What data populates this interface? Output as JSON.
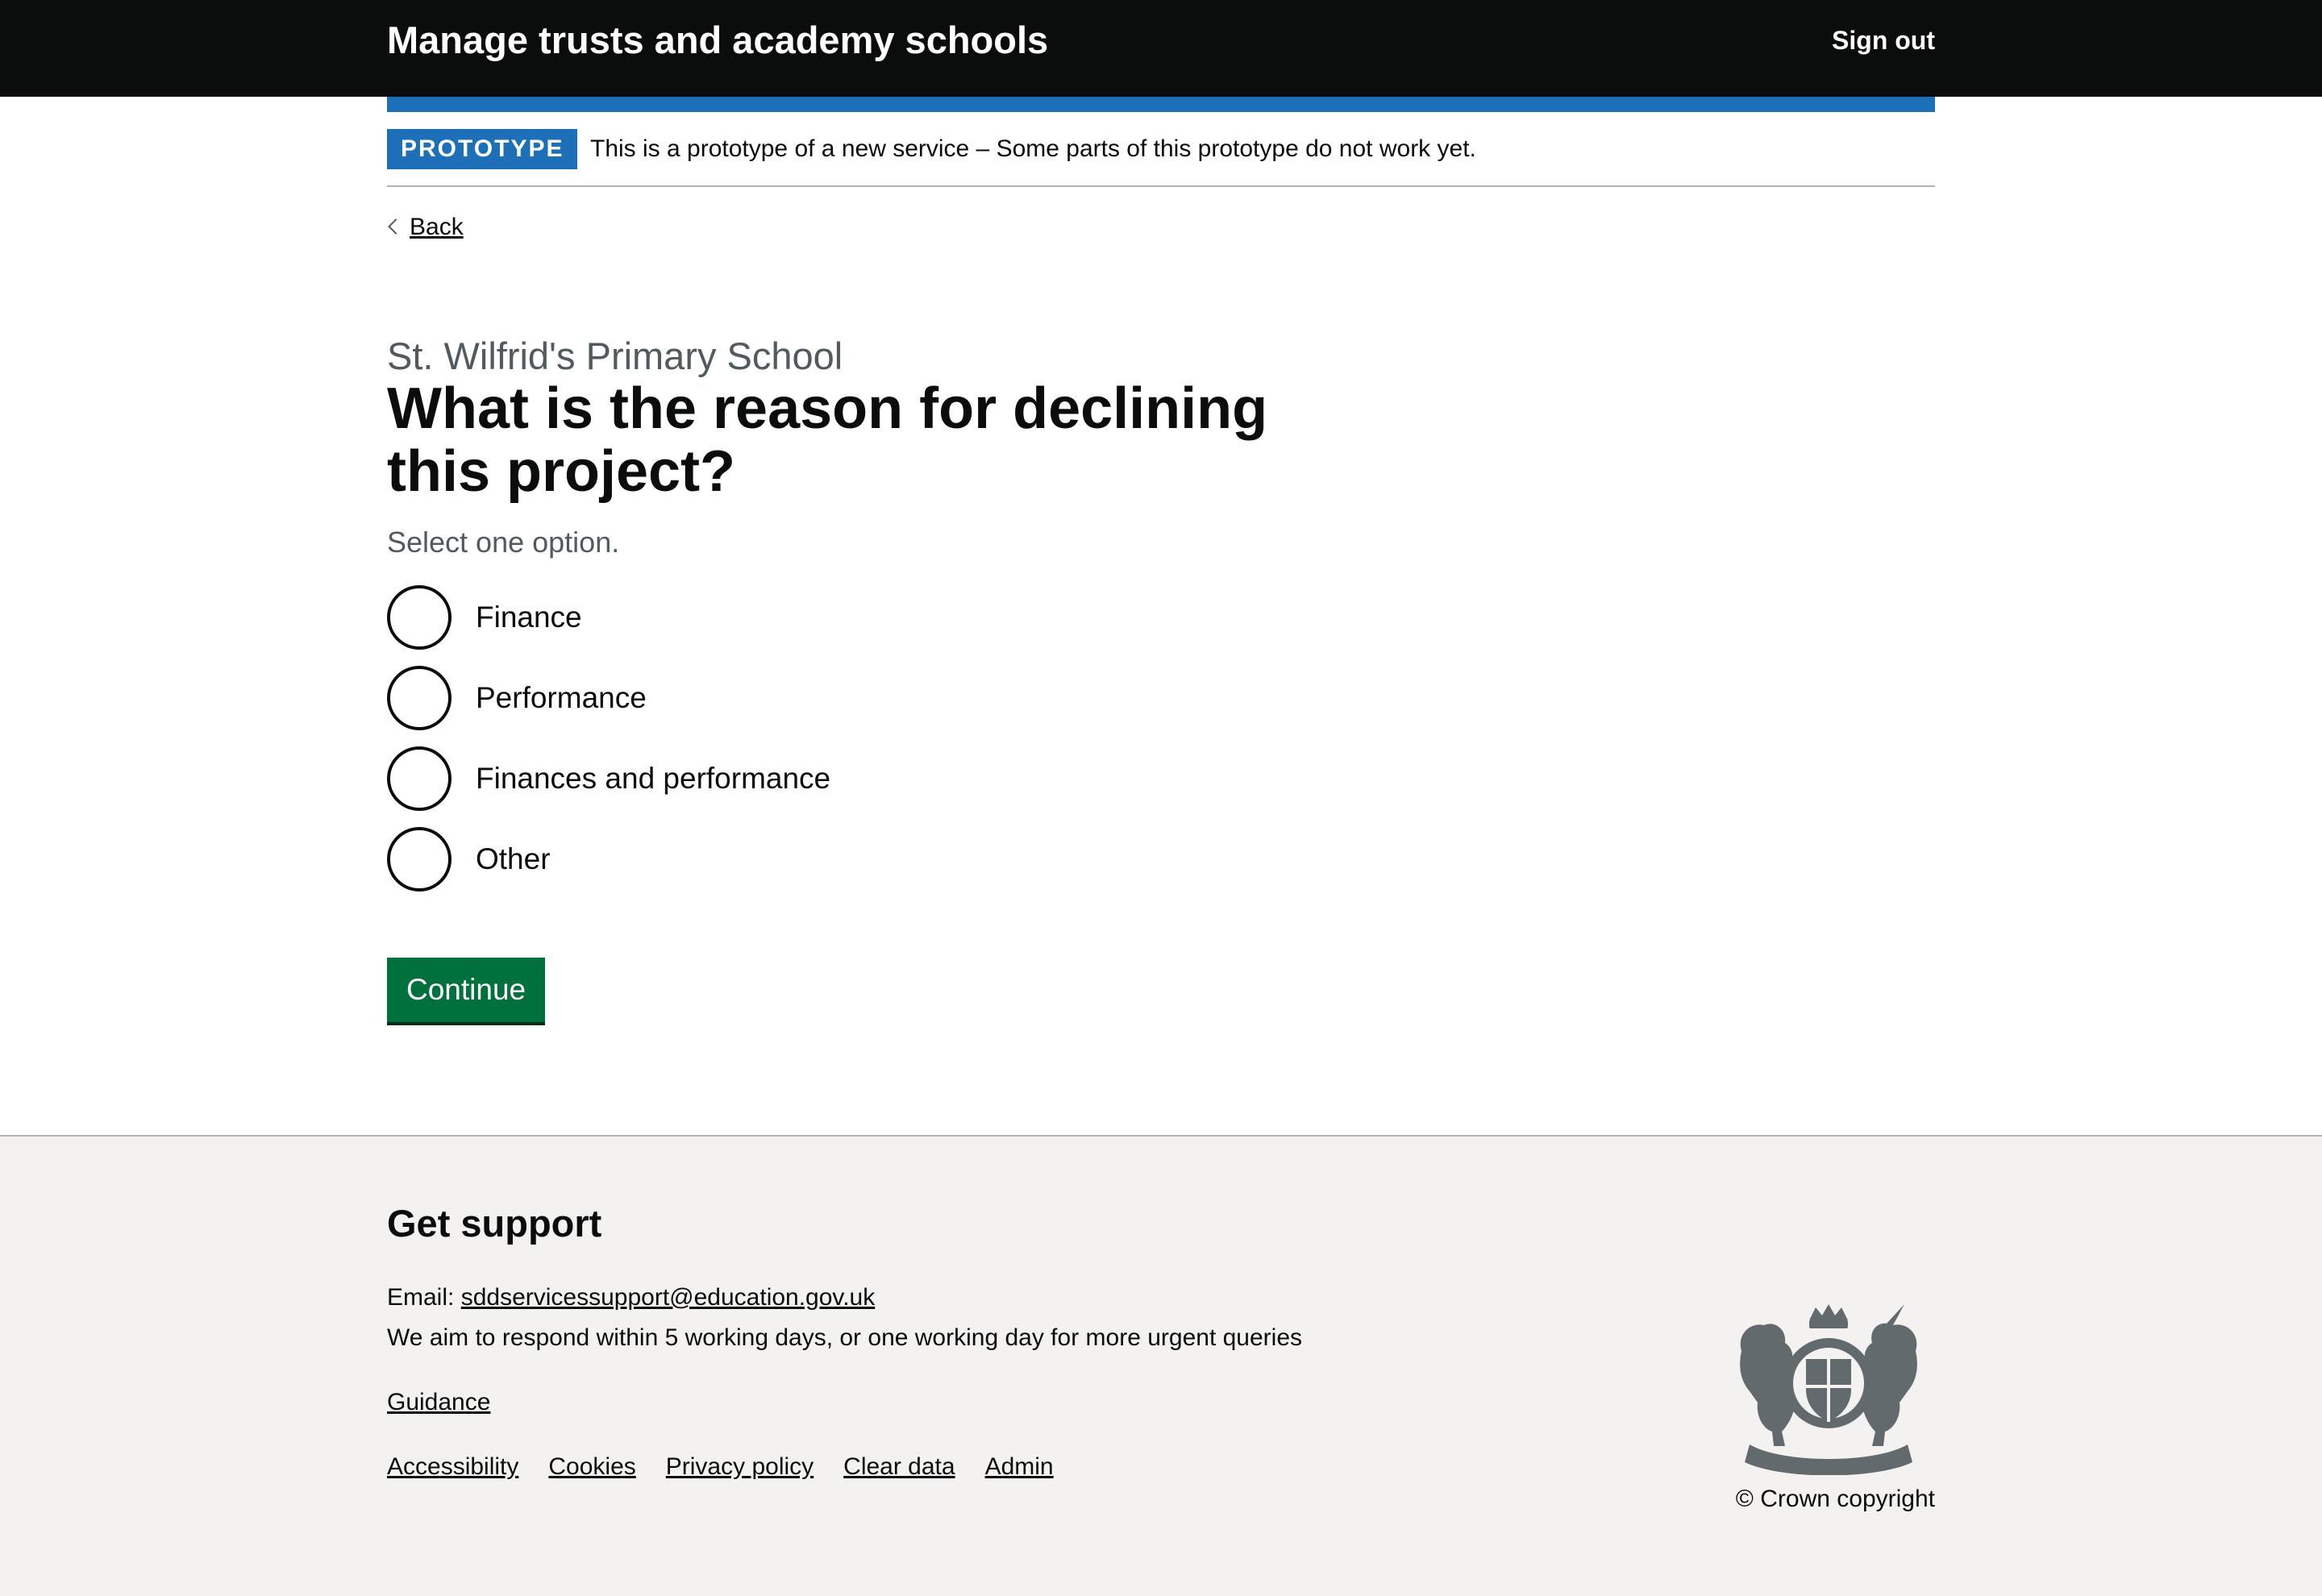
{
  "header": {
    "service_name": "Manage trusts and academy schools",
    "sign_out": "Sign out"
  },
  "phase_banner": {
    "tag": "PROTOTYPE",
    "text": "This is a prototype of a new service – Some parts of this prototype do not work yet."
  },
  "back_link": "Back",
  "main": {
    "caption": "St. Wilfrid's Primary School",
    "heading": "What is the reason for declining this project?",
    "hint": "Select one option.",
    "options": [
      "Finance",
      "Performance",
      "Finances and performance",
      "Other"
    ],
    "continue_label": "Continue"
  },
  "footer": {
    "title": "Get support",
    "email_prefix": "Email:",
    "email": "sddservicessupport@education.gov.uk",
    "respond_text": "We aim to respond within 5 working days, or one working day for more urgent queries",
    "guidance": "Guidance",
    "links": [
      "Accessibility",
      "Cookies",
      "Privacy policy",
      "Clear data",
      "Admin"
    ],
    "copyright": "© Crown copyright"
  },
  "colors": {
    "header_bg": "#0b0c0c",
    "brand_blue": "#1d70b8",
    "button_green": "#00703c",
    "footer_bg": "#f3f2f1",
    "secondary_text": "#505a5f"
  },
  "icons": {
    "back": "chevron-left-icon",
    "crest": "royal-coat-of-arms-icon"
  }
}
